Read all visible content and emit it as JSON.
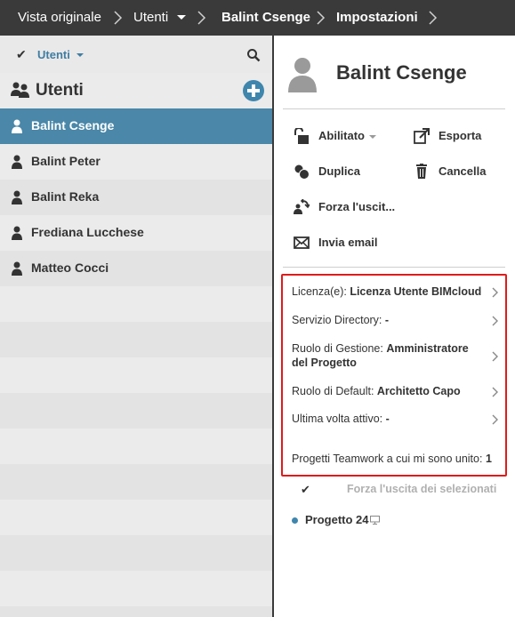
{
  "breadcrumb": {
    "items": [
      "Vista originale",
      "Utenti",
      "Balint Csenge",
      "Impostazioni"
    ]
  },
  "filter": {
    "label": "Utenti",
    "check": "✔"
  },
  "users": {
    "title": "Utenti",
    "list": [
      "Balint Csenge",
      "Balint Peter",
      "Balint Reka",
      "Frediana Lucchese",
      "Matteo Cocci"
    ],
    "selected_index": 0
  },
  "profile": {
    "name": "Balint Csenge"
  },
  "actions": {
    "abilitato": "Abilitato",
    "esporta": "Esporta",
    "duplica": "Duplica",
    "cancella": "Cancella",
    "forza": "Forza l'uscit...",
    "email": "Invia email"
  },
  "properties": {
    "licenza": {
      "label": "Licenza(e): ",
      "value": "Licenza Utente BIMcloud"
    },
    "directory": {
      "label": "Servizio Directory: ",
      "value": "-"
    },
    "ruolo_gestione": {
      "label": "Ruolo di Gestione: ",
      "value": "Amministratore del Progetto"
    },
    "ruolo_default": {
      "label": "Ruolo di Default: ",
      "value": "Architetto Capo"
    },
    "ultima": {
      "label": "Ultima volta attivo: ",
      "value": "-"
    },
    "progetti": {
      "label": "Progetti Teamwork a cui mi sono unito: ",
      "value": "1"
    }
  },
  "projects": {
    "force_label": "Forza l'uscita dei selezionati",
    "check": "✔",
    "items": [
      "Progetto 24"
    ]
  },
  "colors": {
    "accent": "#3f86ad",
    "selected_row": "#4a87a8",
    "topbar": "#3a3a3a",
    "highlight_border": "#e01b1b"
  }
}
